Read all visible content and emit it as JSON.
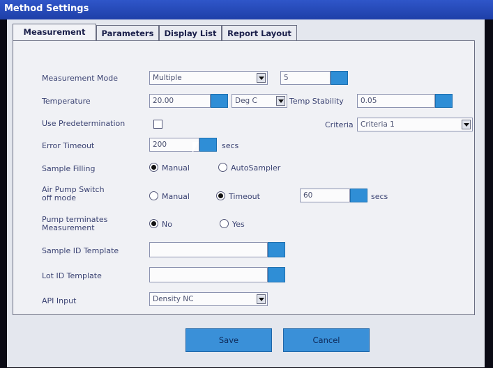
{
  "window": {
    "title": "Method Settings"
  },
  "tabs": [
    {
      "label": "Measurement"
    },
    {
      "label": "Parameters"
    },
    {
      "label": "Display List"
    },
    {
      "label": "Report Layout"
    }
  ],
  "form": {
    "measurement_mode": {
      "label": "Measurement Mode",
      "value": "Multiple",
      "count": "5"
    },
    "temperature": {
      "label": "Temperature",
      "value": "20.00",
      "unit": "Deg C",
      "stability_label": "Temp Stability",
      "stability_value": "0.05"
    },
    "predetermination": {
      "label": "Use Predetermination",
      "checked": false,
      "criteria_label": "Criteria",
      "criteria_value": "Criteria 1"
    },
    "error_timeout": {
      "label": "Error Timeout",
      "value": "200",
      "unit": "secs"
    },
    "sample_filling": {
      "label": "Sample Filling",
      "options": [
        "Manual",
        "AutoSampler"
      ],
      "selected": "Manual"
    },
    "air_pump": {
      "label_line1": "Air Pump Switch",
      "label_line2": "off mode",
      "options": [
        "Manual",
        "Timeout"
      ],
      "selected": "Timeout",
      "value": "60",
      "unit": "secs"
    },
    "pump_terminates": {
      "label_line1": "Pump terminates",
      "label_line2": "Measurement",
      "options": [
        "No",
        "Yes"
      ],
      "selected": "No"
    },
    "sample_id_template": {
      "label": "Sample ID Template",
      "value": ""
    },
    "lot_id_template": {
      "label": "Lot ID Template",
      "value": ""
    },
    "api_input": {
      "label": "API Input",
      "value": "Density NC"
    }
  },
  "buttons": {
    "save": "Save",
    "cancel": "Cancel"
  },
  "colors": {
    "titlebar": "#2f56c9",
    "keypad_button": "#2f8ed6",
    "panel": "#f0f1f5"
  }
}
